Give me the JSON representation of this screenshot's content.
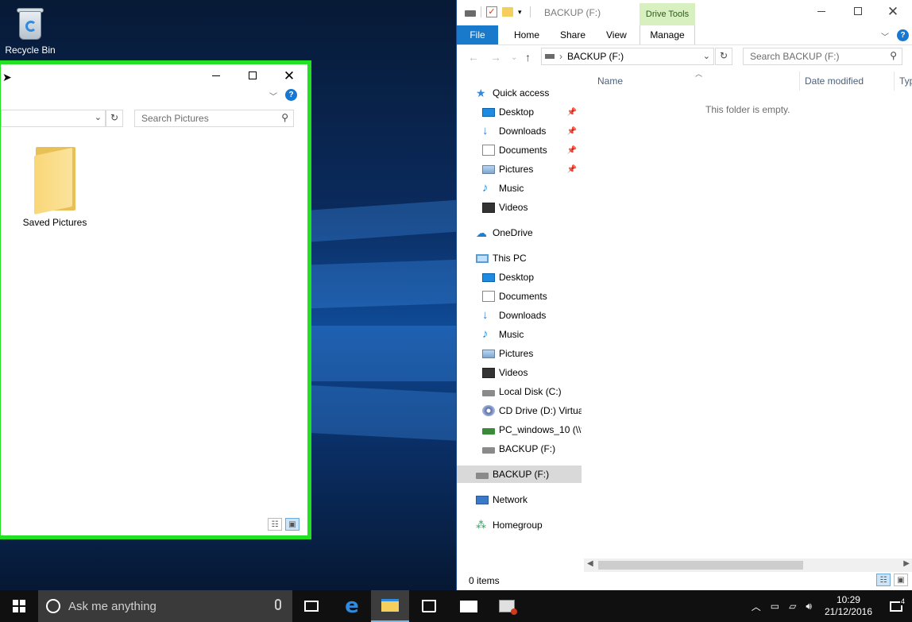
{
  "desktop": {
    "recycle_bin_label": "Recycle Bin"
  },
  "left_window": {
    "search_placeholder": "Search Pictures",
    "folders": [
      {
        "label": "Saved Pictures"
      }
    ]
  },
  "right_window": {
    "title": "BACKUP (F:)",
    "contextual_group": "Drive Tools",
    "tabs": {
      "file": "File",
      "home": "Home",
      "share": "Share",
      "view": "View",
      "manage": "Manage"
    },
    "address": {
      "separator": "›",
      "current": "BACKUP (F:)"
    },
    "search_placeholder": "Search BACKUP (F:)",
    "columns": {
      "name": "Name",
      "date_modified": "Date modified",
      "type": "Type"
    },
    "empty_message": "This folder is empty.",
    "status": "0 items",
    "nav_pane": {
      "quick_access": "Quick access",
      "quick_items": [
        "Desktop",
        "Downloads",
        "Documents",
        "Pictures",
        "Music",
        "Videos"
      ],
      "onedrive": "OneDrive",
      "this_pc": "This PC",
      "pc_items": [
        "Desktop",
        "Documents",
        "Downloads",
        "Music",
        "Pictures",
        "Videos",
        "Local Disk (C:)",
        "CD Drive (D:) Virtua",
        "PC_windows_10 (\\\\v",
        "BACKUP (F:)"
      ],
      "backup_drive": "BACKUP (F:)",
      "network": "Network",
      "homegroup": "Homegroup"
    }
  },
  "taskbar": {
    "search_placeholder": "Ask me anything",
    "time": "10:29",
    "date": "21/12/2016",
    "notification_count": "4"
  }
}
